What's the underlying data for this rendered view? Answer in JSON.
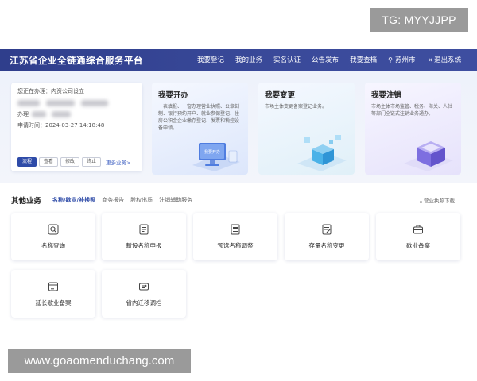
{
  "watermarks": {
    "top": "TG: MYYJJPP",
    "bottom": "www.goaomenduchang.com"
  },
  "header": {
    "title": "江苏省企业全链通综合服务平台",
    "nav": [
      "我要登记",
      "我的业务",
      "实名认证",
      "公告发布",
      "我要查档"
    ],
    "city": "苏州市",
    "logout": "退出系统",
    "location_icon": "location-pin-icon",
    "logout_icon": "logout-icon"
  },
  "pending": {
    "status": "您正在办理：内资公司设立",
    "handler_label": "办理",
    "date": "申请时间：2024-03-27 14:18:48",
    "buttons": [
      "流程",
      "查看",
      "修改",
      "终止"
    ],
    "more": "更多业务>"
  },
  "cards": [
    {
      "title": "我要开办",
      "desc": "一表填报、一窗办理营业执照、公章刻制、银行预约开户、就业参保登记、住房公积金企业缴存登记、发票和税控设备申领。",
      "art_label": "我要开办"
    },
    {
      "title": "我要变更",
      "desc": "市场主体变更备案登记业务。"
    },
    {
      "title": "我要注销",
      "desc": "市场主体市场监管、税务、海关、人社等部门全链式注销业务通办。"
    }
  ],
  "other": {
    "title": "其他业务",
    "tabs": [
      "名称/歇业/补换照",
      "商务报告",
      "股权出质",
      "注销辅助服务"
    ],
    "download": "营业执照下载",
    "download_icon": "download-icon",
    "items": [
      {
        "label": "名称查询",
        "icon": "search-icon"
      },
      {
        "label": "新设名称申报",
        "icon": "form-icon"
      },
      {
        "label": "预选名称调整",
        "icon": "document-icon"
      },
      {
        "label": "存量名称变更",
        "icon": "edit-document-icon"
      },
      {
        "label": "歇业备案",
        "icon": "briefcase-icon"
      },
      {
        "label": "延长歇业备案",
        "icon": "calendar-doc-icon"
      },
      {
        "label": "省内迁移调档",
        "icon": "transfer-icon"
      }
    ]
  }
}
